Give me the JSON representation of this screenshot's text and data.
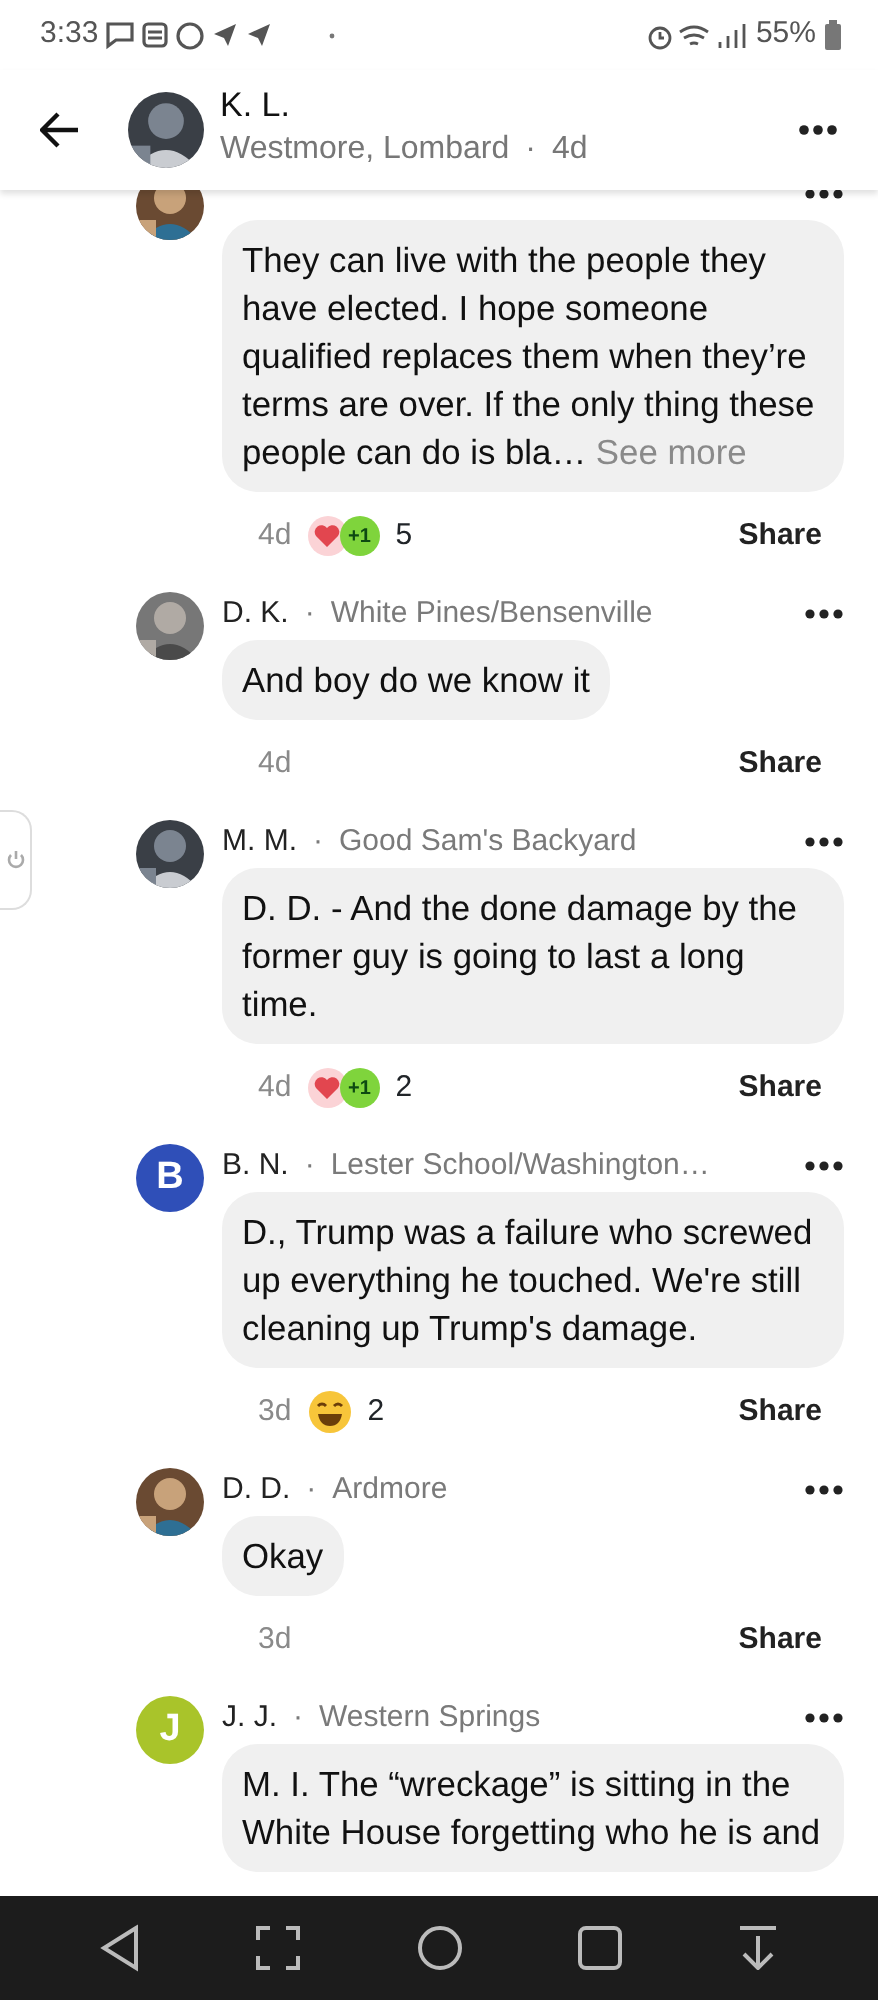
{
  "status_bar": {
    "time": "3:33",
    "battery": "55%"
  },
  "header": {
    "author": "K. L.",
    "location": "Westmore, Lombard",
    "separator": "·",
    "age": "4d"
  },
  "comments": [
    {
      "text": "They can live with the people they have elected.  I hope someone qualified replaces them when they’re terms are over.  If the only thing these people can do is bla… ",
      "see_more": "See more",
      "age": "4d",
      "reactions": [
        {
          "kind": "love"
        },
        {
          "kind": "plus_one",
          "label": "+1"
        }
      ],
      "reaction_count": "5",
      "share": "Share"
    },
    {
      "author": "D. K.",
      "separator": "·",
      "location": "White Pines/Bensenville",
      "text": "And boy do we know it",
      "age": "4d",
      "share": "Share"
    },
    {
      "author": "M. M.",
      "separator": "·",
      "location": "Good Sam's Backyard",
      "text": "D. D.  - And the done damage by the former guy is going to last a long time.",
      "age": "4d",
      "reactions": [
        {
          "kind": "love"
        },
        {
          "kind": "plus_one",
          "label": "+1"
        }
      ],
      "reaction_count": "2",
      "share": "Share"
    },
    {
      "author": "B. N.",
      "separator": "·",
      "location": "Lester School/Washington…",
      "avatar": {
        "kind": "letter",
        "letter": "B",
        "color": "#2f4fb8"
      },
      "text": "D., Trump was a failure who screwed up everything he touched. We're still cleaning up Trump's damage.",
      "age": "3d",
      "reactions": [
        {
          "kind": "laugh"
        }
      ],
      "reaction_count": "2",
      "share": "Share"
    },
    {
      "author": "D. D.",
      "separator": "·",
      "location": "Ardmore",
      "text": "Okay",
      "age": "3d",
      "share": "Share"
    },
    {
      "author": "J. J.",
      "separator": "·",
      "location": "Western Springs",
      "avatar": {
        "kind": "letter",
        "letter": "J",
        "color": "#a9c42a"
      },
      "text": "M. I. The “wreckage” is sitting in the White House forgetting who he is and"
    }
  ]
}
